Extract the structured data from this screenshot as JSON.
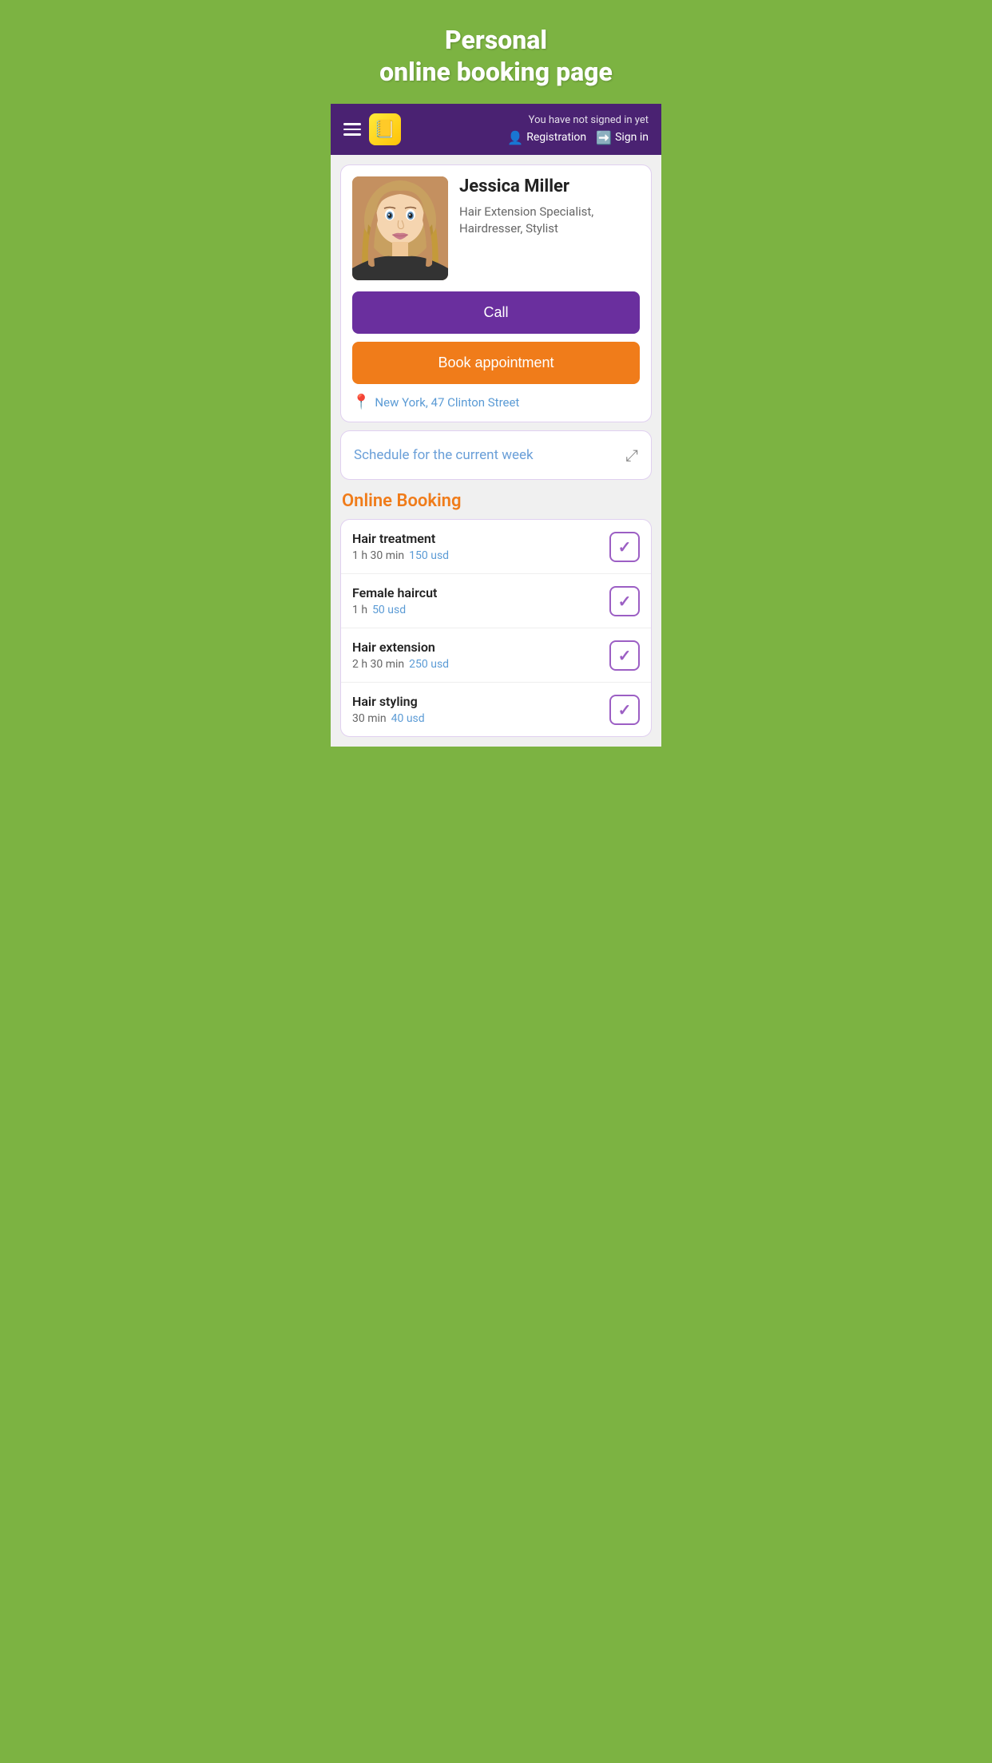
{
  "header": {
    "title_line1": "Personal",
    "title_line2": "online booking page"
  },
  "navbar": {
    "not_signed_in": "You have not signed in yet",
    "registration_label": "Registration",
    "sign_in_label": "Sign in"
  },
  "profile": {
    "name": "Jessica Miller",
    "title": "Hair Extension Specialist, Hairdresser, Stylist",
    "call_button": "Call",
    "book_button": "Book appointment",
    "location": "New York, 47 Clinton Street"
  },
  "schedule": {
    "label": "Schedule for the current week"
  },
  "online_booking": {
    "section_title": "Online Booking",
    "services": [
      {
        "name": "Hair treatment",
        "duration": "1 h 30 min",
        "price": "150 usd",
        "checked": true
      },
      {
        "name": "Female haircut",
        "duration": "1 h",
        "price": "50 usd",
        "checked": true
      },
      {
        "name": "Hair extension",
        "duration": "2 h 30 min",
        "price": "250 usd",
        "checked": true
      },
      {
        "name": "Hair styling",
        "duration": "30 min",
        "price": "40 usd",
        "checked": true
      }
    ]
  },
  "colors": {
    "purple": "#6a2f9e",
    "orange": "#f07c1a",
    "blue_link": "#5b9bd5",
    "navbar_bg": "#4a2272",
    "green_bg": "#7cb342"
  }
}
